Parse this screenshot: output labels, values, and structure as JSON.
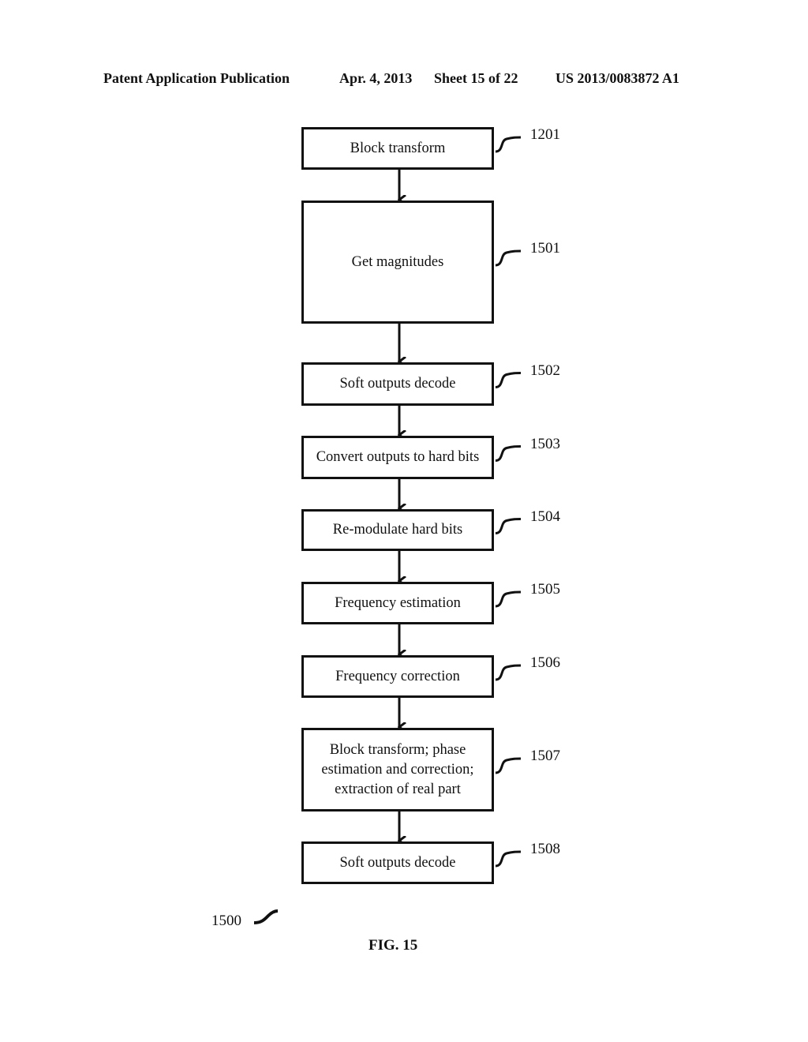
{
  "header": {
    "publication": "Patent Application Publication",
    "date": "Apr. 4, 2013",
    "sheet": "Sheet 15 of 22",
    "number": "US 2013/0083872 A1"
  },
  "flowchart": {
    "steps": [
      {
        "id": "1201",
        "label": "Block transform"
      },
      {
        "id": "1501",
        "label": "Get magnitudes"
      },
      {
        "id": "1502",
        "label": "Soft outputs decode"
      },
      {
        "id": "1503",
        "label": "Convert outputs to hard bits"
      },
      {
        "id": "1504",
        "label": "Re-modulate hard bits"
      },
      {
        "id": "1505",
        "label": "Frequency estimation"
      },
      {
        "id": "1506",
        "label": "Frequency correction"
      },
      {
        "id": "1507",
        "label": "Block transform; phase estimation and correction; extraction of real part"
      },
      {
        "id": "1508",
        "label": "Soft outputs decode"
      }
    ],
    "figure_ref": "1500"
  },
  "figure_label": "FIG. 15"
}
